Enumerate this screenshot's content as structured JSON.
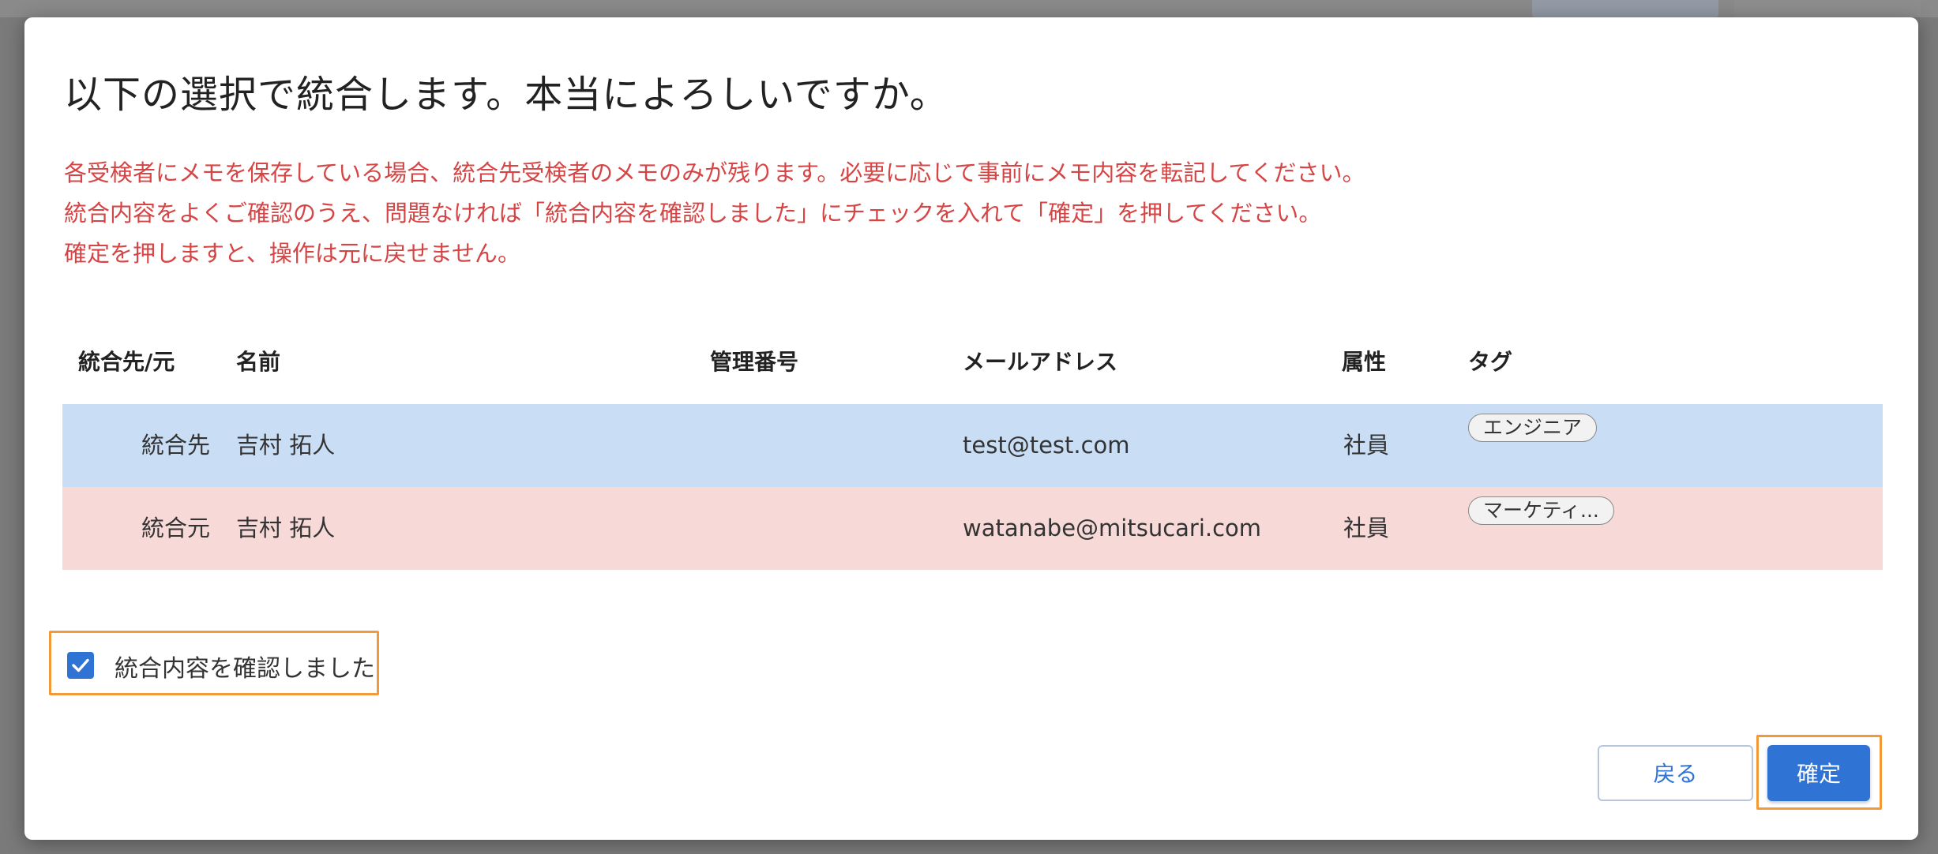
{
  "dialog": {
    "title": "以下の選択で統合します。本当によろしいですか。",
    "warnings": [
      "各受検者にメモを保存している場合、統合先受検者のメモのみが残ります。必要に応じて事前にメモ内容を転記してください。",
      "統合内容をよくご確認のうえ、問題なければ「統合内容を確認しました」にチェックを入れて「確定」を押してください。",
      "確定を押しますと、操作は元に戻せません。"
    ],
    "warning_color": "#d64545"
  },
  "table": {
    "headers": {
      "role": "統合先/元",
      "name": "名前",
      "management_number": "管理番号",
      "email": "メールアドレス",
      "attribute": "属性",
      "tag": "タグ"
    },
    "rows": [
      {
        "role": "統合先",
        "name": "吉村 拓人",
        "management_number": "",
        "email": "test@test.com",
        "attribute": "社員",
        "tag": "エンジニア",
        "row_color": "#c9ddf5"
      },
      {
        "role": "統合元",
        "name": "吉村 拓人",
        "management_number": "",
        "email": "watanabe@mitsucari.com",
        "attribute": "社員",
        "tag": "マーケティ...",
        "row_color": "#f7d9d7"
      }
    ]
  },
  "confirmation": {
    "label": "統合内容を確認しました",
    "checked": true,
    "icon": "checkmark-icon"
  },
  "actions": {
    "back_label": "戻る",
    "confirm_label": "確定",
    "primary_color": "#2f73d4",
    "highlight_color": "#f29a38"
  }
}
